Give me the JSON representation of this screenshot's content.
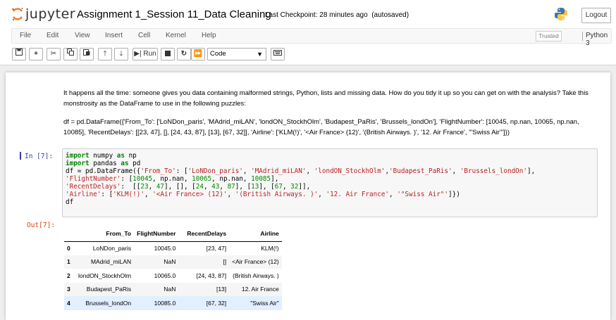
{
  "app": {
    "logo_text": "jupyter",
    "notebook_title": "Assignment 1_Session 11_Data Cleaning",
    "checkpoint": "Last Checkpoint: 28 minutes ago",
    "autosave": "(autosaved)",
    "logout_label": "Logout"
  },
  "menu": {
    "items": [
      "File",
      "Edit",
      "View",
      "Insert",
      "Cell",
      "Kernel",
      "Help"
    ],
    "trusted": "Trusted",
    "kernel": "Python 3"
  },
  "toolbar": {
    "run_label": "Run",
    "cell_type": "Code"
  },
  "markdown": {
    "paragraph1": "It happens all the time: someone gives you data containing malformed strings, Python, lists and missing data. How do you tidy it up so you can get on with the analysis? Take this monstrosity as the DataFrame to use in the following puzzles:",
    "paragraph2": "df = pd.DataFrame({'From_To': ['LoNDon_paris', 'MAdrid_miLAN', 'londON_StockhOlm', 'Budapest_PaRis', 'Brussels_londOn'], 'FlightNumber': [10045, np.nan, 10065, np.nan, 10085], 'RecentDelays': [[23, 47], [], [24, 43, 87], [13], [67, 32]], 'Airline': ['KLM(!)', '<Air France> (12)', '(British Airways. )', '12. Air France', '\"Swiss Air\"']})"
  },
  "code_cell": {
    "in_prompt": "In [7]:",
    "out_prompt": "Out[7]:"
  },
  "table": {
    "headers": [
      "",
      "From_To",
      "FlightNumber",
      "RecentDelays",
      "Airline"
    ],
    "rows": [
      [
        "0",
        "LoNDon_paris",
        "10045.0",
        "[23, 47]",
        "KLM(!)"
      ],
      [
        "1",
        "MAdrid_miLAN",
        "NaN",
        "[]",
        "<Air France> (12)"
      ],
      [
        "2",
        "londON_StockhOlm",
        "10065.0",
        "[24, 43, 87]",
        "(British Airways. )"
      ],
      [
        "3",
        "Budapest_PaRis",
        "NaN",
        "[13]",
        "12. Air France"
      ],
      [
        "4",
        "Brussels_londOn",
        "10085.0",
        "[67, 32]",
        "\"Swiss Air\""
      ]
    ]
  }
}
